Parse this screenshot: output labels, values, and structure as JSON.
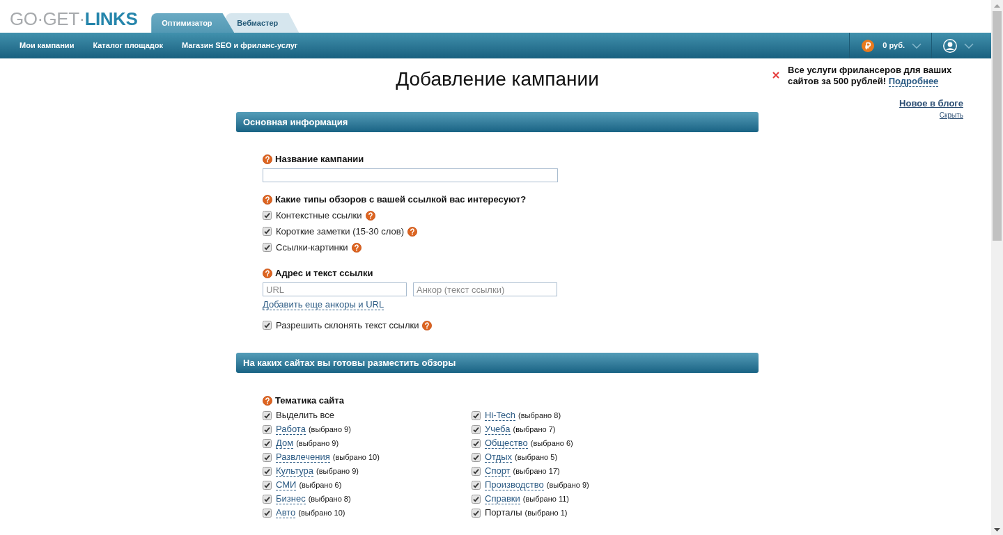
{
  "header": {
    "logo": [
      "GO·GET·",
      "LINKS"
    ],
    "tabs": [
      {
        "label": "Оптимизатор",
        "selected": true
      },
      {
        "label": "Вебмастер",
        "selected": false
      }
    ]
  },
  "nav": {
    "items": [
      "Мои кампании",
      "Каталог площадок",
      "Магазин SEO и фриланс-услуг"
    ],
    "balance": "0 руб."
  },
  "promo": {
    "text": "Все услуги фрилансеров для ваших сайтов за 500 рублей!",
    "link": "Подробнее"
  },
  "blog": {
    "link": "Новое в блоге",
    "hide": "Скрыть"
  },
  "page_title": "Добавление кампании",
  "sections": [
    {
      "title": "Основная информация",
      "fields": [
        {
          "kind": "text",
          "label": "Название кампании"
        },
        {
          "kind": "checkgroup",
          "label": "Какие типы обзоров с вашей ссылкой вас интересуют?",
          "options": [
            {
              "label": "Контекстные ссылки",
              "checked": true
            },
            {
              "label": "Короткие заметки (15-30 слов)",
              "checked": true
            },
            {
              "label": "Ссылки-картинки",
              "checked": true
            }
          ]
        },
        {
          "kind": "link_inputs",
          "label": "Адрес и текст ссылки",
          "inputs": [
            {
              "placeholder": "URL"
            },
            {
              "placeholder": "Анкор (текст ссылки)"
            }
          ],
          "add_link": "Добавить еще анкоры и URL"
        },
        {
          "kind": "checkbox",
          "label": "Разрешить склонять текст ссылки",
          "checked": true
        }
      ]
    },
    {
      "title": "На каких сайтах вы готовы разместить обзоры",
      "fields": [
        {
          "kind": "topics",
          "label": "Тематика сайта",
          "columns": [
            [
              {
                "kind": "plain",
                "label": "Выделить все",
                "checked": true
              },
              {
                "kind": "link",
                "label": "Работа",
                "count": "(выбрано 9)",
                "checked": true
              },
              {
                "kind": "link",
                "label": "Дом",
                "count": "(выбрано 9)",
                "checked": true
              },
              {
                "kind": "link",
                "label": "Развлечения",
                "count": "(выбрано 10)",
                "checked": true
              },
              {
                "kind": "link",
                "label": "Культура",
                "count": "(выбрано 9)",
                "checked": true
              },
              {
                "kind": "link",
                "label": "СМИ",
                "count": "(выбрано 6)",
                "checked": true
              },
              {
                "kind": "link",
                "label": "Бизнес",
                "count": "(выбрано 8)",
                "checked": true
              },
              {
                "kind": "link",
                "label": "Авто",
                "count": "(выбрано 10)",
                "checked": true
              }
            ],
            [
              {
                "kind": "link",
                "label": "Hi-Tech",
                "count": "(выбрано 8)",
                "checked": true
              },
              {
                "kind": "link",
                "label": "Учеба",
                "count": "(выбрано 7)",
                "checked": true
              },
              {
                "kind": "link",
                "label": "Общество",
                "count": "(выбрано 6)",
                "checked": true
              },
              {
                "kind": "link",
                "label": "Отдых",
                "count": "(выбрано 5)",
                "checked": true
              },
              {
                "kind": "link",
                "label": "Спорт",
                "count": "(выбрано 17)",
                "checked": true
              },
              {
                "kind": "link",
                "label": "Производство",
                "count": "(выбрано 9)",
                "checked": true
              },
              {
                "kind": "link",
                "label": "Справки",
                "count": "(выбрано 11)",
                "checked": true
              },
              {
                "kind": "plain",
                "label": "Порталы",
                "count": "(выбрано 1)",
                "checked": true
              }
            ]
          ]
        }
      ]
    }
  ]
}
